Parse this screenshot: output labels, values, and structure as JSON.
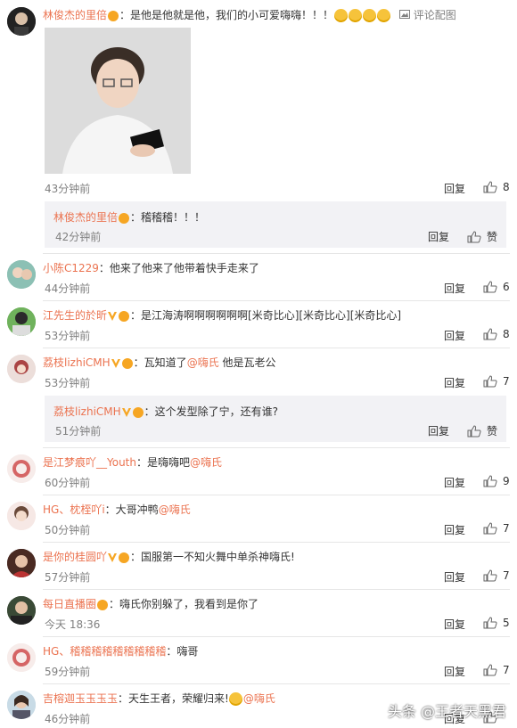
{
  "comments": [
    {
      "name": "林俊杰的里倍",
      "text": "：是他是他就是他，我们的小可爱嗨嗨！！！",
      "extra": "评论配图",
      "time": "43分钟前",
      "reply": "回复",
      "likes": "8"
    },
    {
      "name": "小陈C1229",
      "text": "：他来了他来了他带着快手走来了",
      "time": "44分钟前",
      "reply": "回复",
      "likes": "6"
    },
    {
      "name": "江先生的於昕",
      "text": "：是江海涛啊啊啊啊啊啊[米奇比心][米奇比心][米奇比心]",
      "time": "53分钟前",
      "reply": "回复",
      "likes": "8"
    },
    {
      "name": "荔枝lizhiCMH",
      "text": "：瓦知道了",
      "mention": "@嗨氏",
      "text2": " 他是瓦老公",
      "time": "53分钟前",
      "reply": "回复",
      "likes": "7"
    },
    {
      "name": "是江梦痕吖__Youth",
      "text": "：是嗨嗨吧",
      "mention": "@嗨氏",
      "time": "60分钟前",
      "reply": "回复",
      "likes": "9"
    },
    {
      "name": "HG、枕桎吖i",
      "text": "：大哥冲鸭",
      "mention": "@嗨氏",
      "time": "50分钟前",
      "reply": "回复",
      "likes": "7"
    },
    {
      "name": "是你的桂圆吖",
      "text": "：国服第一不知火舞中单杀神嗨氏!",
      "time": "57分钟前",
      "reply": "回复",
      "likes": "7"
    },
    {
      "name": "每日直播圈",
      "text": "：嗨氏你别躲了，我看到是你了",
      "time": "今天 18:36",
      "reply": "回复",
      "likes": "5"
    },
    {
      "name": "HG、稽稽稽稽稽稽稽稽稽",
      "text": "：嗨哥",
      "time": "59分钟前",
      "reply": "回复",
      "likes": "7"
    },
    {
      "name": "吉榕迦玉玉玉玉",
      "text": "：天生王者，荣耀归来!",
      "mention": "@嗨氏",
      "time": "46分钟前",
      "reply": "回复",
      "likes": ""
    }
  ],
  "replies": [
    {
      "name": "林俊杰的里倍",
      "text": "：稽稽稽！！！",
      "time": "42分钟前",
      "reply": "回复",
      "like_label": "赞"
    },
    {
      "name": "荔枝lizhiCMH",
      "text": "：这个发型除了宁，还有谁?",
      "time": "51分钟前",
      "reply": "回复",
      "like_label": "赞"
    }
  ],
  "watermark": "头条 @王者天黑君",
  "colors": {
    "name": "#eb7350",
    "time": "#808080",
    "reply_bg": "#f2f2f5",
    "divider": "#e6e6e6"
  }
}
